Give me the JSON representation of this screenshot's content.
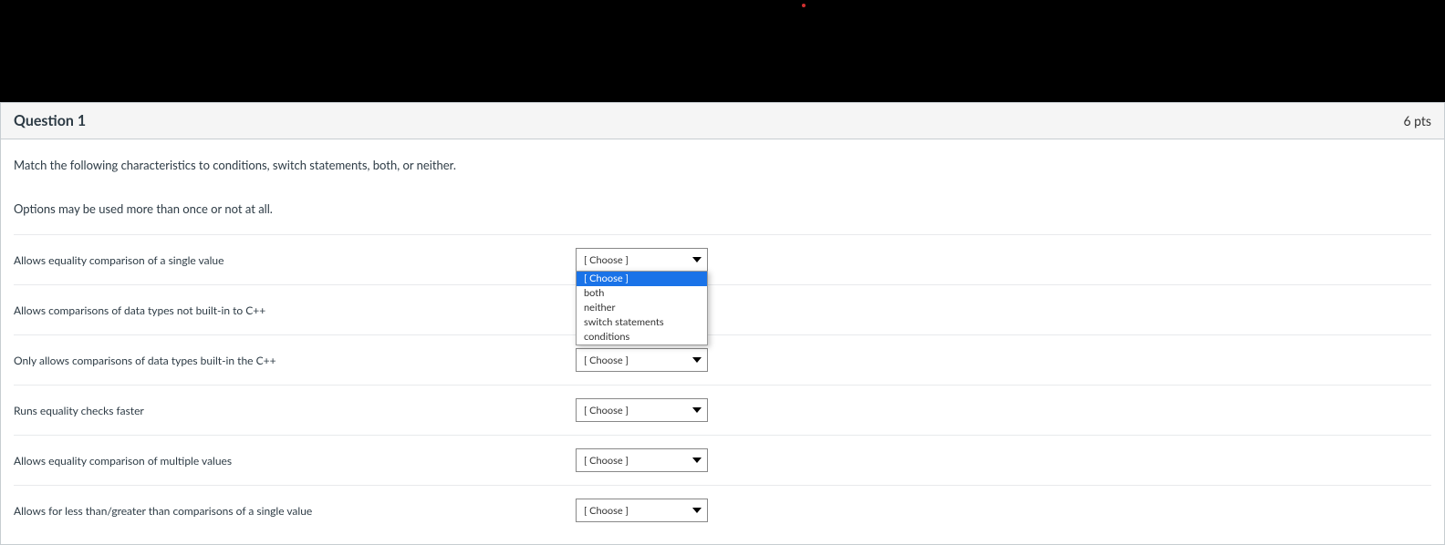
{
  "header": {
    "question_title": "Question 1",
    "points": "6 pts"
  },
  "prompt": {
    "line1": "Match the following characteristics to conditions, switch statements, both, or neither.",
    "line2": "Options may be used more than once or not at all."
  },
  "select_placeholder": "[ Choose ]",
  "dropdown_options": [
    "[ Choose ]",
    "both",
    "neither",
    "switch statements",
    "conditions"
  ],
  "rows": [
    {
      "label": "Allows equality comparison of a single value",
      "value": "[ Choose ]",
      "open": true
    },
    {
      "label": "Allows comparisons of data types not built-in to C++",
      "value": "[ Choose ]",
      "open": false
    },
    {
      "label": "Only allows comparisons of data types built-in the C++",
      "value": "[ Choose ]",
      "open": false
    },
    {
      "label": "Runs equality checks faster",
      "value": "[ Choose ]",
      "open": false
    },
    {
      "label": "Allows equality comparison of multiple values",
      "value": "[ Choose ]",
      "open": false
    },
    {
      "label": "Allows for less than/greater than comparisons of a single value",
      "value": "[ Choose ]",
      "open": false
    }
  ]
}
